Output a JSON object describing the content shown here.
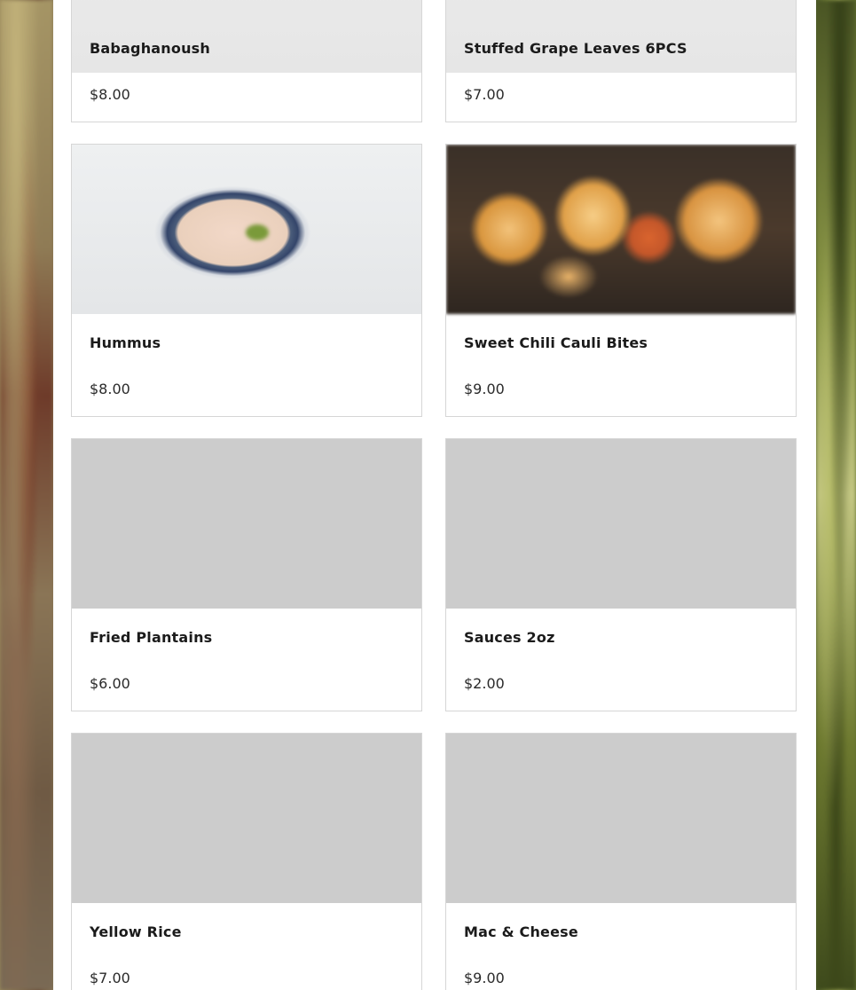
{
  "menu": {
    "items": [
      {
        "title": "Babaghanoush",
        "price": "$8.00",
        "image": "babaghanoush-photo"
      },
      {
        "title": "Stuffed Grape Leaves 6PCS",
        "price": "$7.00",
        "image": "grape-leaves-photo"
      },
      {
        "title": "Hummus",
        "price": "$8.00",
        "image": "hummus-photo"
      },
      {
        "title": "Sweet Chili Cauli Bites",
        "price": "$9.00",
        "image": "cauli-bites-photo"
      },
      {
        "title": "Fried Plantains",
        "price": "$6.00",
        "image": "placeholder"
      },
      {
        "title": "Sauces 2oz",
        "price": "$2.00",
        "image": "placeholder"
      },
      {
        "title": "Yellow Rice",
        "price": "$7.00",
        "image": "placeholder"
      },
      {
        "title": "Mac & Cheese",
        "price": "$9.00",
        "image": "placeholder"
      }
    ]
  },
  "colors": {
    "card_border": "#d6d6d6",
    "placeholder_image": "#cccccc",
    "text": "#1b1b1b"
  }
}
